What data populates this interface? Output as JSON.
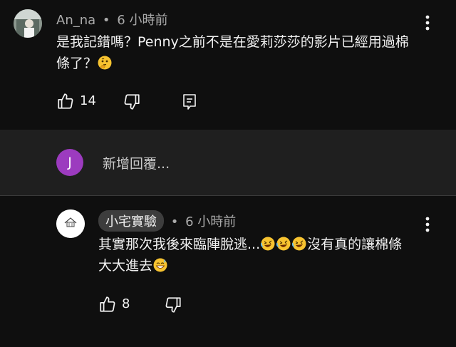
{
  "comment1": {
    "author": "An_na",
    "separator": "•",
    "time": "6 小時前",
    "text_line1": "是我記錯嗎？Penny之前不是在愛莉莎莎的影片已經用過棉",
    "text_line2": "條了？",
    "like_count": "14",
    "avatar_icon": "user-photo-avatar",
    "emoji": "thinking-face-emoji"
  },
  "reply_box": {
    "avatar_letter": "J",
    "avatar_color": "#9c3bbf",
    "placeholder": "新增回覆..."
  },
  "comment2": {
    "author": "小宅實驗",
    "separator": "•",
    "time": "6 小時前",
    "text_part1": "其實那次我後來臨陣脫逃...",
    "text_part2": "沒有真的讓棉條",
    "text_line2": "大大進去",
    "like_count": "8",
    "avatar_icon": "channel-logo-avatar",
    "logo_text": "小宅實驗",
    "emoji_laugh": "rolling-laughing-emoji",
    "emoji_sweat": "grinning-sweat-emoji"
  },
  "colors": {
    "background": "#0f0f0f",
    "reply_bar": "#1f1f1f",
    "meta_text": "#aaaaaa",
    "chip": "#3d3d3d"
  }
}
